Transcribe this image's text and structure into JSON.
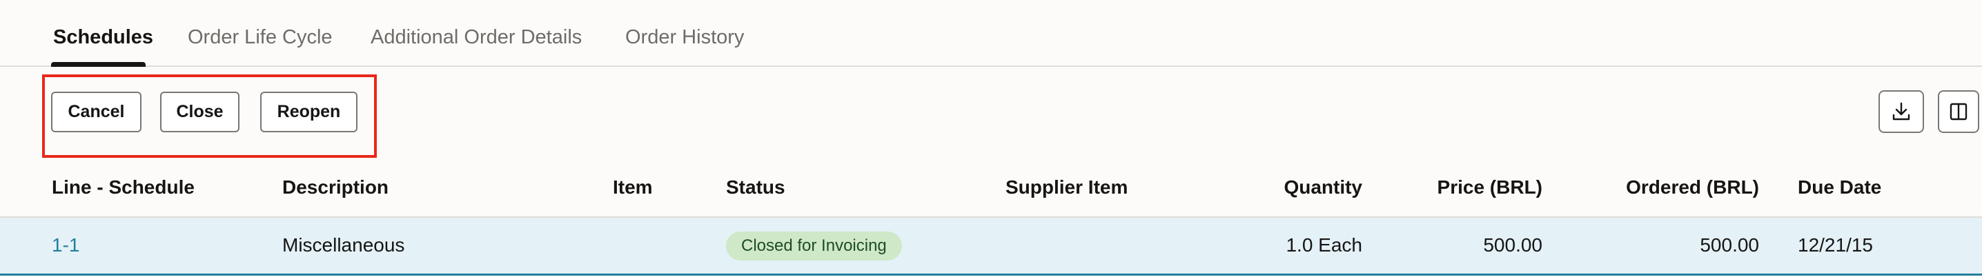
{
  "tabs": [
    {
      "label": "Schedules",
      "active": true
    },
    {
      "label": "Order Life Cycle",
      "active": false
    },
    {
      "label": "Additional Order Details",
      "active": false
    },
    {
      "label": "Order History",
      "active": false
    }
  ],
  "toolbar": {
    "cancel_label": "Cancel",
    "close_label": "Close",
    "reopen_label": "Reopen",
    "export_icon": "download-icon",
    "columns_icon": "columns-icon"
  },
  "table": {
    "columns": [
      "Line - Schedule",
      "Description",
      "Item",
      "Status",
      "Supplier Item",
      "Quantity",
      "Price (BRL)",
      "Ordered (BRL)",
      "Due Date"
    ],
    "rows": [
      {
        "line_schedule": "1-1",
        "description": "Miscellaneous",
        "item": "",
        "status": "Closed for Invoicing",
        "supplier_item": "",
        "quantity": "1.0 Each",
        "price": "500.00",
        "ordered": "500.00",
        "due_date": "12/21/15"
      }
    ]
  },
  "colors": {
    "highlight": "#e8281b",
    "link": "#227e9e",
    "row_selected": "#e4f1f7",
    "status_badge": "#cfe8c8"
  }
}
